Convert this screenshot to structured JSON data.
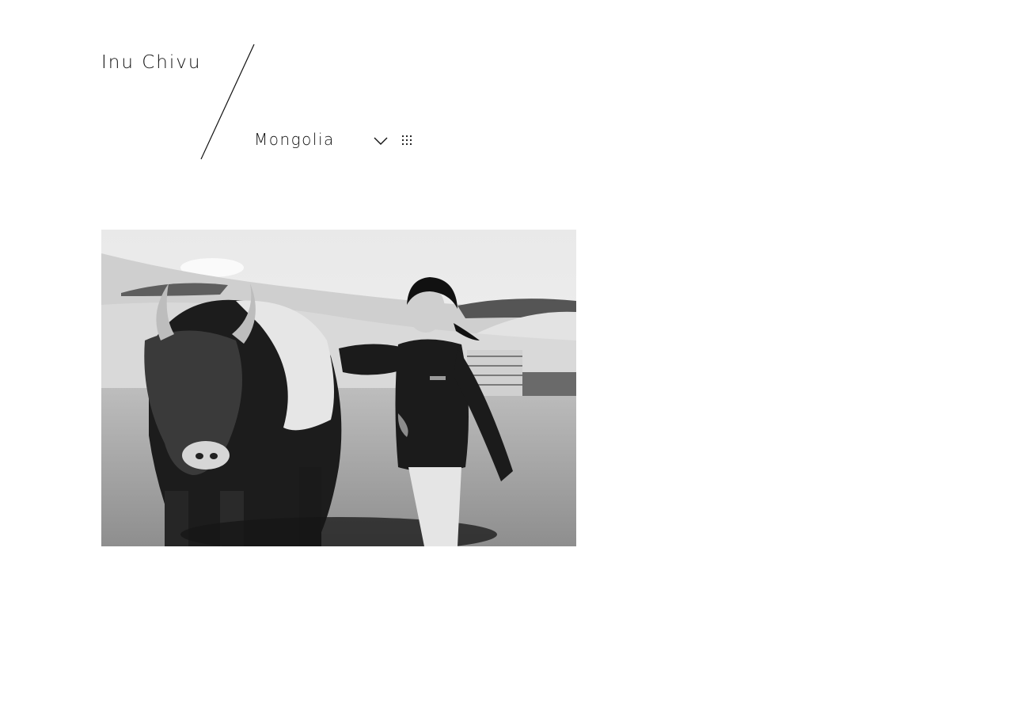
{
  "site": {
    "title": "Inu Chivu"
  },
  "nav": {
    "gallery_label": "Mongolia",
    "dropdown_icon": "chevron-down-icon",
    "grid_icon": "grid-dots-icon"
  },
  "photo": {
    "alt": "Black and white photo of a smiling girl walking beside a yak on the Mongolian steppe",
    "style": "black-and-white"
  },
  "colors": {
    "text": "#111111",
    "background": "#ffffff"
  }
}
